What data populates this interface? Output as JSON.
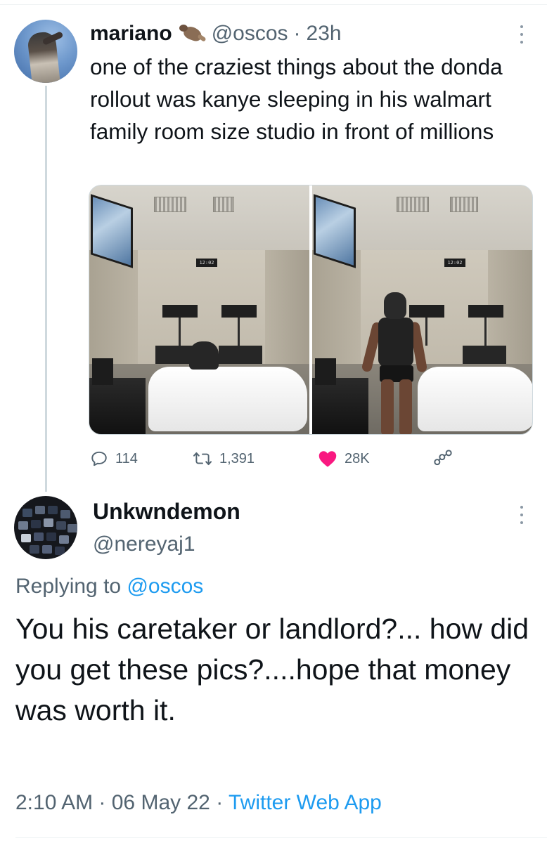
{
  "tweet": {
    "author": {
      "name": "mariano",
      "handle": "@oscos"
    },
    "time": "23h",
    "text": "one of the craziest things about the donda rollout was kanye sleeping in his walmart family room size studio in front of millions",
    "photos": [
      {
        "clock_text": "12:02"
      },
      {
        "clock_text": "12:02"
      }
    ],
    "actions": {
      "replies": "114",
      "retweets": "1,391",
      "likes": "28K"
    },
    "colors": {
      "like": "#f91880",
      "muted": "#536471",
      "link": "#1d9bf0"
    },
    "icons": [
      "reply-icon",
      "retweet-icon",
      "heart-icon",
      "share-icon",
      "more-icon"
    ]
  },
  "reply": {
    "author": {
      "name": "Unkwndemon",
      "handle": "@nereyaj1"
    },
    "replying_to_prefix": "Replying to",
    "replying_to_handle": "@oscos",
    "text": "You his caretaker or landlord?... how did you get these pics?....hope that money was worth it.",
    "time": "2:10 AM",
    "date": "06 May 22",
    "source": "Twitter Web App"
  }
}
